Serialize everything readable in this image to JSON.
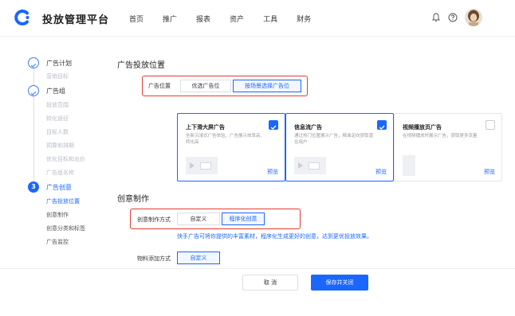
{
  "header": {
    "brand": "投放管理平台",
    "nav": [
      "首页",
      "推广",
      "报表",
      "资产",
      "工具",
      "财务"
    ]
  },
  "sidebar": {
    "steps": [
      {
        "title": "广告计划",
        "state": "done",
        "subs": [
          "营销目标"
        ]
      },
      {
        "title": "广告组",
        "state": "done",
        "subs": [
          "投放范围",
          "转化途径",
          "目标人数",
          "预算和排期",
          "优化目标和出价",
          "广告组名称"
        ]
      },
      {
        "title": "广告创意",
        "state": "active",
        "badge": "3",
        "subs": [
          "广告投放位置",
          "创意制作",
          "创意分类和标签",
          "广告监控"
        ]
      }
    ]
  },
  "placement": {
    "section_title": "广告投放位置",
    "label": "广告位置",
    "option_preferred": "优选广告位",
    "option_scene": "按场景选择广告位"
  },
  "cards": [
    {
      "title": "上下滑大屏广告",
      "desc": "全新沉浸式广告体验，广告展示效率高，转化高",
      "preview": "预览",
      "checked": true
    },
    {
      "title": "信息流广告",
      "desc": "通过热门位置展示广告，精准定向获取潜在用户",
      "preview": "预览",
      "checked": true
    },
    {
      "title": "视频播放页广告",
      "desc": "在视频播放时展示广告，获取更多流量",
      "preview": "预览",
      "checked": false
    }
  ],
  "creative": {
    "section_title": "创意制作",
    "mode_label": "创意制作方式",
    "option_custom": "自定义",
    "option_programmatic": "程序化创意",
    "hint": "快手广告可将你提供的丰富素材，程序化生成更好的创意，达到更优投放效果。",
    "material_label": "物料添加方式",
    "material_value": "自定义"
  },
  "footer": {
    "cancel": "取 消",
    "save": "保存并关闭"
  },
  "colors": {
    "primary": "#1a66ff",
    "highlight_border": "#e33b2e"
  }
}
